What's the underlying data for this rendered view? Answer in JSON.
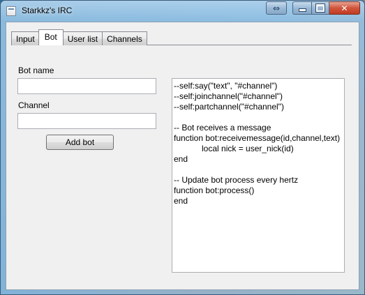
{
  "window": {
    "title": "Starkkz's IRC"
  },
  "tabs": [
    {
      "label": "Input"
    },
    {
      "label": "Bot"
    },
    {
      "label": "User list"
    },
    {
      "label": "Channels"
    }
  ],
  "bot_form": {
    "bot_name_label": "Bot name",
    "bot_name_value": "",
    "channel_label": "Channel",
    "channel_value": "",
    "add_button": "Add bot"
  },
  "code_editor": {
    "lines": [
      "--self:say(\"text\", \"#channel\")",
      "--self:joinchannel(\"#channel\")",
      "--self:partchannel(\"#channel\")",
      "",
      "-- Bot receives a message",
      "function bot:receivemessage(id,channel,text)",
      "            local nick = user_nick(id)",
      "end",
      "",
      "-- Update bot process every hertz",
      "function bot:process()",
      "end"
    ]
  },
  "icons": {
    "app": "application-icon",
    "extra": "resize-arrows-icon",
    "minimize": "minimize-icon",
    "maximize": "maximize-icon",
    "close": "close-icon"
  },
  "caption_glyphs": {
    "extra": "⇔",
    "close": "✕"
  }
}
